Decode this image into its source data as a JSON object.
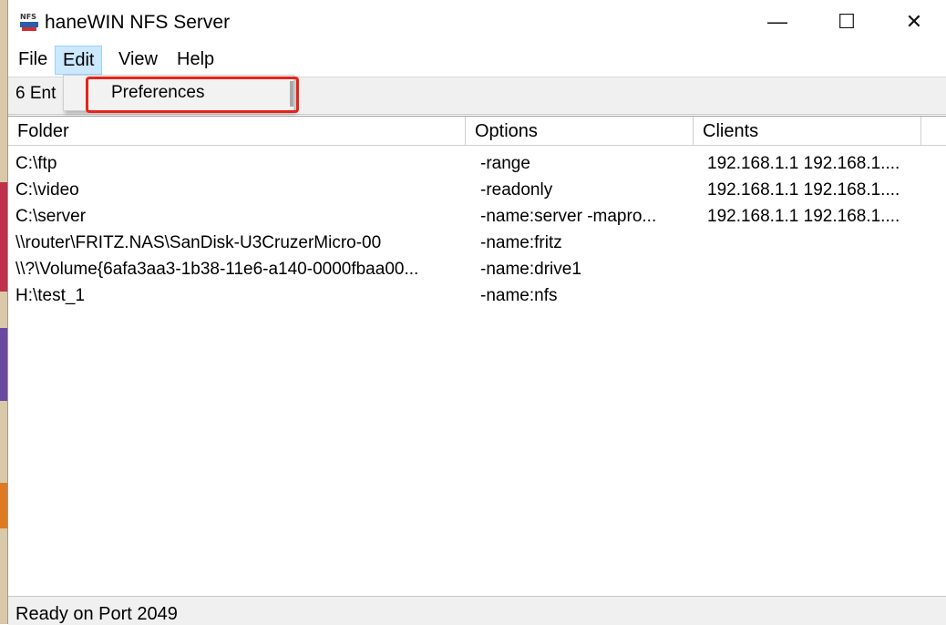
{
  "window": {
    "title": "haneWIN NFS Server",
    "minimize_glyph": "—",
    "maximize_glyph": "☐",
    "close_glyph": "✕"
  },
  "menubar": {
    "items": [
      "File",
      "Edit",
      "View",
      "Help"
    ],
    "active": "Edit"
  },
  "edit_menu": {
    "items": [
      "Preferences"
    ]
  },
  "toolbar": {
    "entries_text": "6 Ent"
  },
  "table": {
    "columns": [
      "Folder",
      "Options",
      "Clients"
    ],
    "rows": [
      {
        "folder": "C:\\ftp",
        "options": "-range",
        "clients": "192.168.1.1 192.168.1...."
      },
      {
        "folder": "C:\\video",
        "options": "-readonly",
        "clients": "192.168.1.1 192.168.1...."
      },
      {
        "folder": "C:\\server",
        "options": "-name:server -mapro...",
        "clients": "192.168.1.1 192.168.1...."
      },
      {
        "folder": "\\\\router\\FRITZ.NAS\\SanDisk-U3CruzerMicro-00",
        "options": "-name:fritz",
        "clients": ""
      },
      {
        "folder": "\\\\?\\Volume{6afa3aa3-1b38-11e6-a140-0000fbaa00...",
        "options": "-name:drive1",
        "clients": ""
      },
      {
        "folder": "H:\\test_1",
        "options": "-name:nfs",
        "clients": ""
      }
    ]
  },
  "status": {
    "text": "Ready on Port 2049"
  },
  "colors": {
    "highlight": "#e8231a",
    "menu_active": "#cce8ff"
  }
}
